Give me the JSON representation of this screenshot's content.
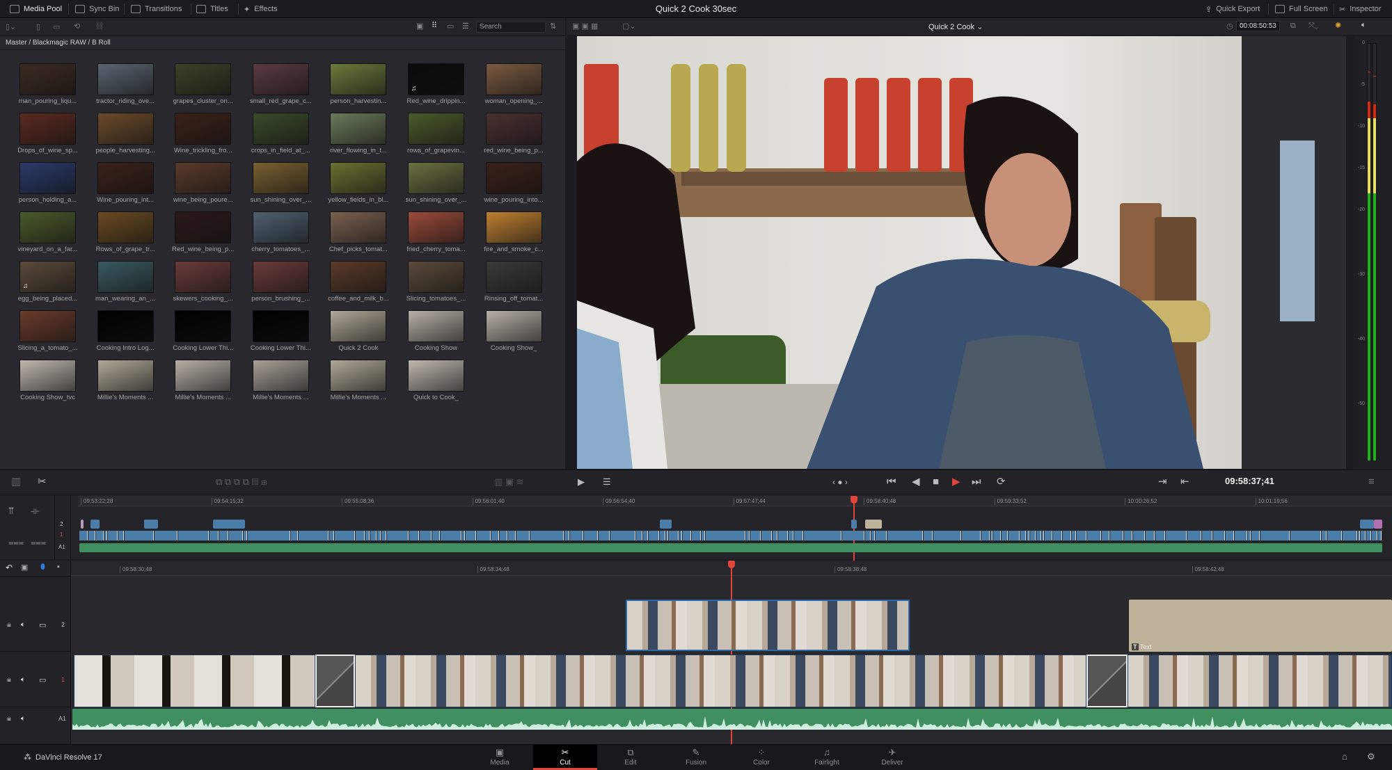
{
  "topbar": {
    "tabs": [
      {
        "label": "Media Pool",
        "icon": "media-pool-icon",
        "active": true
      },
      {
        "label": "Sync Bin",
        "icon": "sync-bin-icon"
      },
      {
        "label": "Transitions",
        "icon": "transitions-icon"
      },
      {
        "label": "Titles",
        "icon": "titles-icon"
      },
      {
        "label": "Effects",
        "icon": "effects-icon"
      }
    ],
    "project_title": "Quick 2 Cook 30sec",
    "right": [
      {
        "label": "Quick Export",
        "icon": "export-icon"
      },
      {
        "label": "Full Screen",
        "icon": "fullscreen-icon"
      },
      {
        "label": "Inspector",
        "icon": "inspector-icon"
      }
    ]
  },
  "pool": {
    "search_placeholder": "Search",
    "breadcrumb": "Master / Blackmagic RAW / B Roll",
    "items": [
      {
        "n": "man_pouring_liqu...",
        "c": "#3b2a22"
      },
      {
        "n": "tractor_riding_ove...",
        "c": "#5a6470"
      },
      {
        "n": "grapes_cluster_on...",
        "c": "#3a4228"
      },
      {
        "n": "small_red_grape_c...",
        "c": "#5a3a40"
      },
      {
        "n": "person_harvestin...",
        "c": "#6a7a3a"
      },
      {
        "n": "Red_wine_drippin...",
        "c": "#0a0a0a",
        "audio": true
      },
      {
        "n": "woman_opening_...",
        "c": "#7a5a40"
      },
      {
        "n": "Drops_of_wine_sp...",
        "c": "#5a2a20"
      },
      {
        "n": "people_harvesting...",
        "c": "#6a4a2a"
      },
      {
        "n": "Wine_trickling_fro...",
        "c": "#3a2018"
      },
      {
        "n": "crops_in_field_at_...",
        "c": "#3a4a2a"
      },
      {
        "n": "river_flowing_in_t...",
        "c": "#6a7a5a"
      },
      {
        "n": "rows_of_grapevin...",
        "c": "#4a5a2a"
      },
      {
        "n": "red_wine_being_p...",
        "c": "#4a3030"
      },
      {
        "n": "person_holding_a...",
        "c": "#2a3a6a"
      },
      {
        "n": "Wine_pouring_int...",
        "c": "#3a2018"
      },
      {
        "n": "wine_being_poure...",
        "c": "#5a3a2a"
      },
      {
        "n": "sun_shining_over_...",
        "c": "#7a6030"
      },
      {
        "n": "yellow_fields_in_bl...",
        "c": "#6a7030"
      },
      {
        "n": "sun_shining_over_...",
        "c": "#6a7040"
      },
      {
        "n": "wine_pouring_into...",
        "c": "#3a2018"
      },
      {
        "n": "vineyard_on_a_far...",
        "c": "#4a5a2a"
      },
      {
        "n": "Rows_of_grape_tr...",
        "c": "#6a4a20"
      },
      {
        "n": "Red_wine_being_p...",
        "c": "#2a1818"
      },
      {
        "n": "cherry_tomatoes_...",
        "c": "#506070"
      },
      {
        "n": "Chef_picks_tomat...",
        "c": "#7a6050"
      },
      {
        "n": "fried_cherry_toma...",
        "c": "#9a4a3a"
      },
      {
        "n": "fire_and_smoke_c...",
        "c": "#c08030"
      },
      {
        "n": "egg_being_placed...",
        "c": "#5a4a3a",
        "audio": true
      },
      {
        "n": "man_wearing_an_...",
        "c": "#3a5a60"
      },
      {
        "n": "skewers_cooking_...",
        "c": "#6a3a3a"
      },
      {
        "n": "person_brushing_...",
        "c": "#6a3a3a"
      },
      {
        "n": "coffee_and_milk_b...",
        "c": "#5a3a28"
      },
      {
        "n": "Slicing_tomatoes_...",
        "c": "#5a4a3a"
      },
      {
        "n": "Rinsing_off_tomat...",
        "c": "#3a3a38"
      },
      {
        "n": "Slicing_a_tomato_...",
        "c": "#6a3a2a"
      },
      {
        "n": "Cooking Intro Log...",
        "c": "#000000"
      },
      {
        "n": "Cooking Lower Thi...",
        "c": "#000000"
      },
      {
        "n": "Cooking Lower Thi...",
        "c": "#000000"
      },
      {
        "n": "Quick 2 Cook",
        "c": "#b0a898"
      },
      {
        "n": "Cooking Show",
        "c": "#b8b0a8"
      },
      {
        "n": "Cooking Show_",
        "c": "#b8b0a8"
      },
      {
        "n": "Cooking Show_tvc",
        "c": "#c0b8b0"
      },
      {
        "n": "Millie's Moments ...",
        "c": "#b0a898"
      },
      {
        "n": "Millie's Moments ...",
        "c": "#b8b0a8"
      },
      {
        "n": "Millie's Moments ...",
        "c": "#a8a098"
      },
      {
        "n": "Millie's Moments ...",
        "c": "#b0a898"
      },
      {
        "n": "Quick to Cook_",
        "c": "#c0b8b0"
      }
    ]
  },
  "viewer": {
    "timeline_name": "Quick 2 Cook",
    "timecode": "00:08:50:53"
  },
  "meter": {
    "scale": [
      "0",
      "-5",
      "-10",
      "-15",
      "-20",
      "-30",
      "-40",
      "-50"
    ],
    "level_db": [
      -7,
      -7.3
    ],
    "peak_db": [
      -3.4,
      -3.9
    ],
    "colors": {
      "green": "#15b815",
      "yellow": "#e8e050",
      "red": "#d62810"
    }
  },
  "transport": {
    "current_timecode": "09:58:37;41"
  },
  "upper_timeline": {
    "ruler": [
      "09:53:22;28",
      "09:54:15;32",
      "09:55:08;36",
      "09:56:01;40",
      "09:56:54;40",
      "09:57:47;44",
      "09:58:40;48",
      "09:59:33;52",
      "10:00:26;52",
      "10:01:19;56"
    ],
    "tracks": [
      "2",
      "1",
      "A1"
    ]
  },
  "lower_timeline": {
    "ruler": [
      "09:58:30;48",
      "09:58:34;48",
      "09:58:38;48",
      "09:58:42;48"
    ],
    "tracks": [
      "2",
      "1",
      "A1"
    ],
    "text_clip_label": "Text"
  },
  "colors": {
    "video_clip": "#4a7ca8",
    "audio_clip": "#3f8f60",
    "title_clip": "#bdb29a",
    "playhead": "#e0443a"
  },
  "app": {
    "name": "DaVinci Resolve 17"
  },
  "pages": [
    {
      "label": "Media",
      "icon": "media-page-icon"
    },
    {
      "label": "Cut",
      "icon": "cut-page-icon",
      "active": true
    },
    {
      "label": "Edit",
      "icon": "edit-page-icon"
    },
    {
      "label": "Fusion",
      "icon": "fusion-page-icon"
    },
    {
      "label": "Color",
      "icon": "color-page-icon"
    },
    {
      "label": "Fairlight",
      "icon": "fairlight-page-icon"
    },
    {
      "label": "Deliver",
      "icon": "deliver-page-icon"
    }
  ]
}
